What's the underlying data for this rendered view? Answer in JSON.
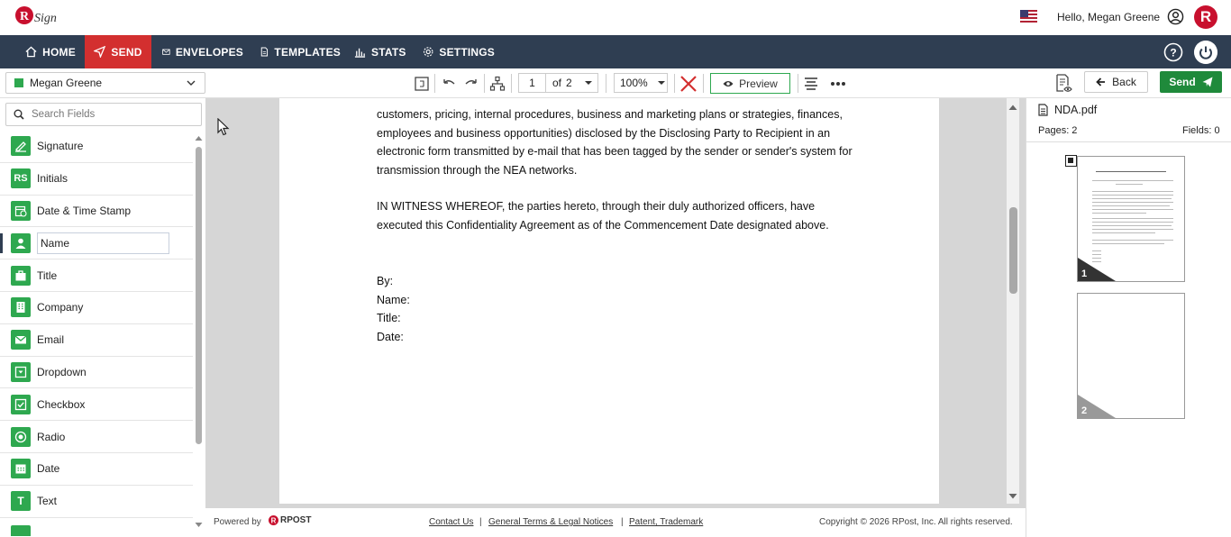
{
  "header": {
    "greeting": "Hello, Megan Greene",
    "avatar_letter": "R",
    "logo_text": "RSign",
    "brand_color": "#c8102e"
  },
  "nav": {
    "items": [
      {
        "label": "HOME",
        "icon": "home-icon"
      },
      {
        "label": "SEND",
        "icon": "send-icon",
        "active": true
      },
      {
        "label": "ENVELOPES",
        "icon": "envelope-icon"
      },
      {
        "label": "TEMPLATES",
        "icon": "template-icon"
      },
      {
        "label": "STATS",
        "icon": "stats-icon"
      },
      {
        "label": "SETTINGS",
        "icon": "gear-icon"
      }
    ],
    "bg_color": "#2f3e52",
    "active_color": "#d32f2f"
  },
  "toolbar": {
    "signer": "Megan Greene",
    "page_current": "1",
    "page_of": "of",
    "page_total": "2",
    "zoom": "100%",
    "preview_label": "Preview",
    "back_label": "Back",
    "send_label": "Send"
  },
  "fields_panel": {
    "search_placeholder": "Search Fields",
    "fields": [
      {
        "label": "Signature",
        "icon": "signature-icon"
      },
      {
        "label": "Initials",
        "icon": "initials-icon"
      },
      {
        "label": "Date & Time Stamp",
        "icon": "calendar-clock-icon"
      },
      {
        "label": "Name",
        "icon": "person-icon",
        "selected": true
      },
      {
        "label": "Title",
        "icon": "briefcase-icon"
      },
      {
        "label": "Company",
        "icon": "building-icon"
      },
      {
        "label": "Email",
        "icon": "mail-icon"
      },
      {
        "label": "Dropdown",
        "icon": "dropdown-icon"
      },
      {
        "label": "Checkbox",
        "icon": "checkbox-icon"
      },
      {
        "label": "Radio",
        "icon": "radio-icon"
      },
      {
        "label": "Date",
        "icon": "calendar-icon"
      },
      {
        "label": "Text",
        "icon": "text-icon"
      }
    ],
    "accent_color": "#2ea84f"
  },
  "document": {
    "paragraph1": [
      "customers, pricing, internal procedures, business and marketing plans or strategies, finances,",
      "employees and business opportunities) disclosed by the Disclosing Party to Recipient in an",
      "electronic form transmitted by e-mail that has been tagged by the sender or sender's system for",
      "transmission through the NEA networks."
    ],
    "paragraph2": [
      "IN WITNESS WHEREOF, the parties hereto, through their duly authorized officers, have",
      "executed this Confidentiality Agreement as of the Commencement Date designated above."
    ],
    "sign_lines": [
      "By:",
      "Name:",
      "Title:",
      "Date:"
    ]
  },
  "right_panel": {
    "file_name": "NDA.pdf",
    "pages_label": "Pages: 2",
    "fields_label": "Fields: 0",
    "thumbnails": [
      "1",
      "2"
    ]
  },
  "footer": {
    "powered_by": "Powered by",
    "powered_brand": "RPOST",
    "links": [
      "Contact Us",
      "General Terms & Legal Notices",
      "Patent, Trademark"
    ],
    "separator": "|",
    "copyright": "Copyright © 2026 RPost, Inc. All rights reserved."
  }
}
